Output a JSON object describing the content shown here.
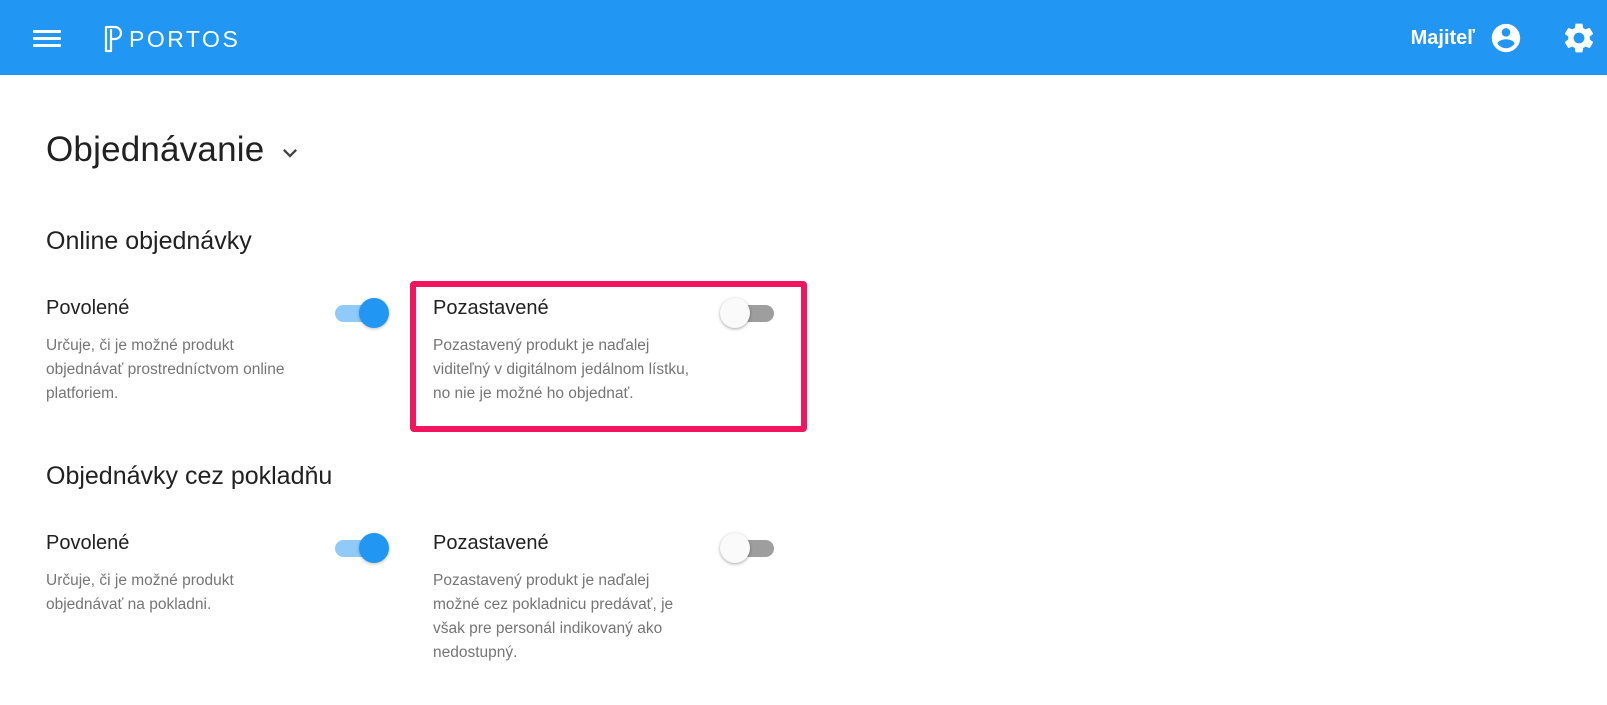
{
  "appbar": {
    "brand": "PORTOS",
    "user_name": "Majiteľ",
    "icons": {
      "menu": "menu-icon",
      "logo": "portos-logo-icon",
      "account": "account-circle-icon",
      "settings": "gear-icon"
    },
    "color": "#2196f3"
  },
  "page": {
    "title": "Objednávanie",
    "title_toggle_icon": "chevron-down-icon"
  },
  "sections": [
    {
      "heading": "Online objednávky",
      "settings": [
        {
          "label": "Povolené",
          "description": "Určuje, či je možné produkt objednávať prostredníctvom online platforiem.",
          "enabled": true
        },
        {
          "label": "Pozastavené",
          "description": "Pozastavený produkt je naďalej viditeľný v digitálnom jedálnom lístku, no nie je možné ho objednať.",
          "enabled": false,
          "highlighted": true
        }
      ]
    },
    {
      "heading": "Objednávky cez pokladňu",
      "settings": [
        {
          "label": "Povolené",
          "description": "Určuje, či je možné produkt objednávať na pokladni.",
          "enabled": true
        },
        {
          "label": "Pozastavené",
          "description": "Pozastavený produkt je naďalej možné cez pokladnicu predávať, je však pre personál indikovaný ako nedostupný.",
          "enabled": false
        }
      ]
    }
  ],
  "colors": {
    "switch_on_thumb": "#2196f3",
    "switch_on_track": "#90caf9",
    "switch_off_track": "#9e9e9e",
    "highlight": "#f2145f"
  }
}
